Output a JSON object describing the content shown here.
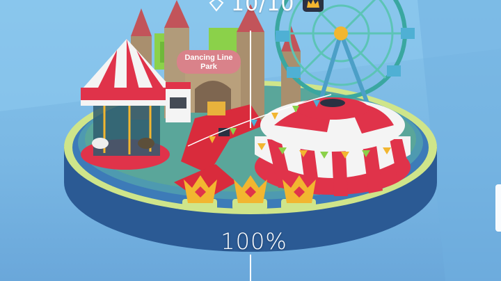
{
  "hud": {
    "counter_text": "10/10",
    "counter_icon": "diamond-icon",
    "badge_icon": "crown-badge-icon"
  },
  "level": {
    "sign_line1": "Dancing Line",
    "sign_line2": "Park",
    "completion": "100%",
    "crowns_collected": 3,
    "crowns_total": 3
  },
  "colors": {
    "sky": "#7ab8e4",
    "tent_red": "#e0334a",
    "tent_white": "#f4f4f4",
    "platform_blue": "#2d5d9a",
    "platform_rim": "#cfe58a",
    "crown_gold": "#f2b630",
    "path_red": "#d92b3c",
    "castle_stone": "#a98f6e"
  }
}
